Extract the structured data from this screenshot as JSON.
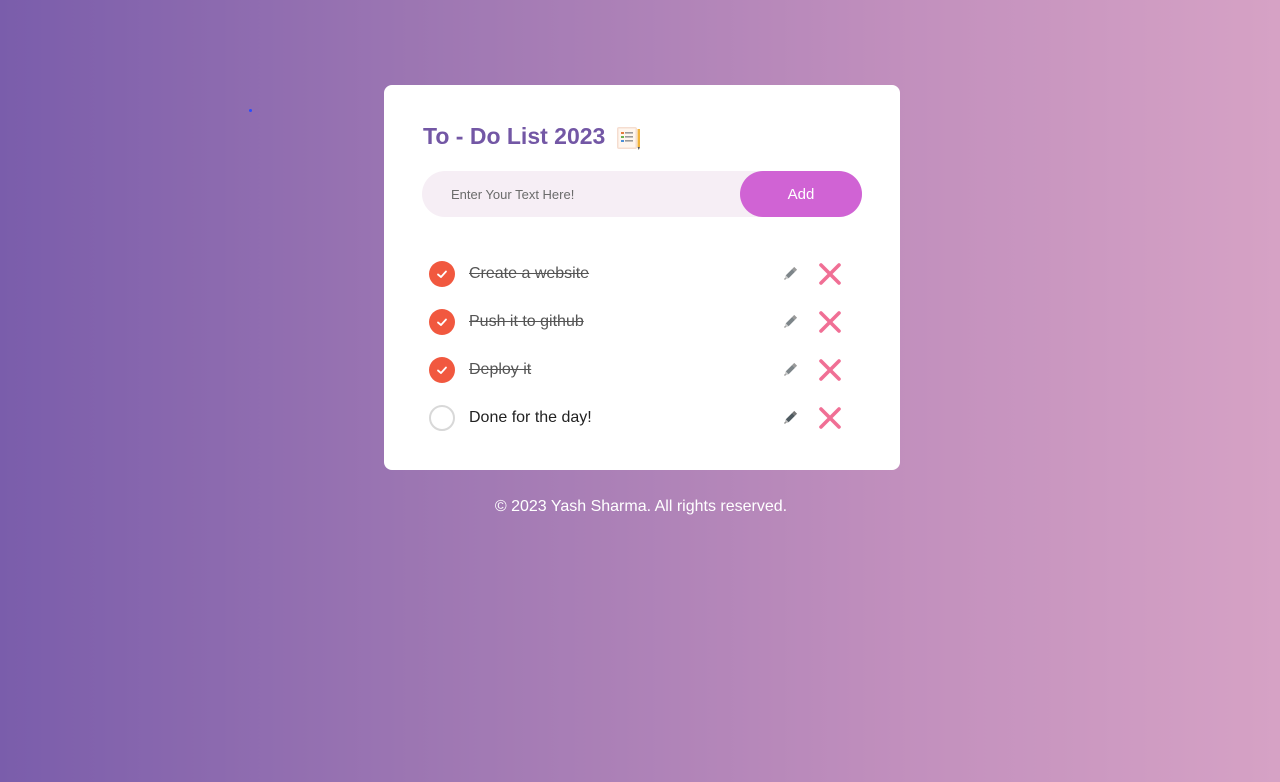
{
  "app": {
    "title": "To - Do List 2023",
    "title_icon": "notepad-icon"
  },
  "input": {
    "placeholder": "Enter Your Text Here!",
    "value": "",
    "add_label": "Add"
  },
  "tasks": [
    {
      "text": "Create a website",
      "done": true
    },
    {
      "text": "Push it to github",
      "done": true
    },
    {
      "text": "Deploy it",
      "done": true
    },
    {
      "text": "Done for the day!",
      "done": false
    }
  ],
  "icons": {
    "check": "checkmark-icon",
    "edit": "pencil-icon",
    "delete": "cross-icon"
  },
  "colors": {
    "accent": "#7357a5",
    "button": "#d063d4",
    "check_done": "#f1583f",
    "delete": "#f06f95"
  },
  "footer": {
    "text": "© 2023 Yash Sharma. All rights reserved."
  }
}
